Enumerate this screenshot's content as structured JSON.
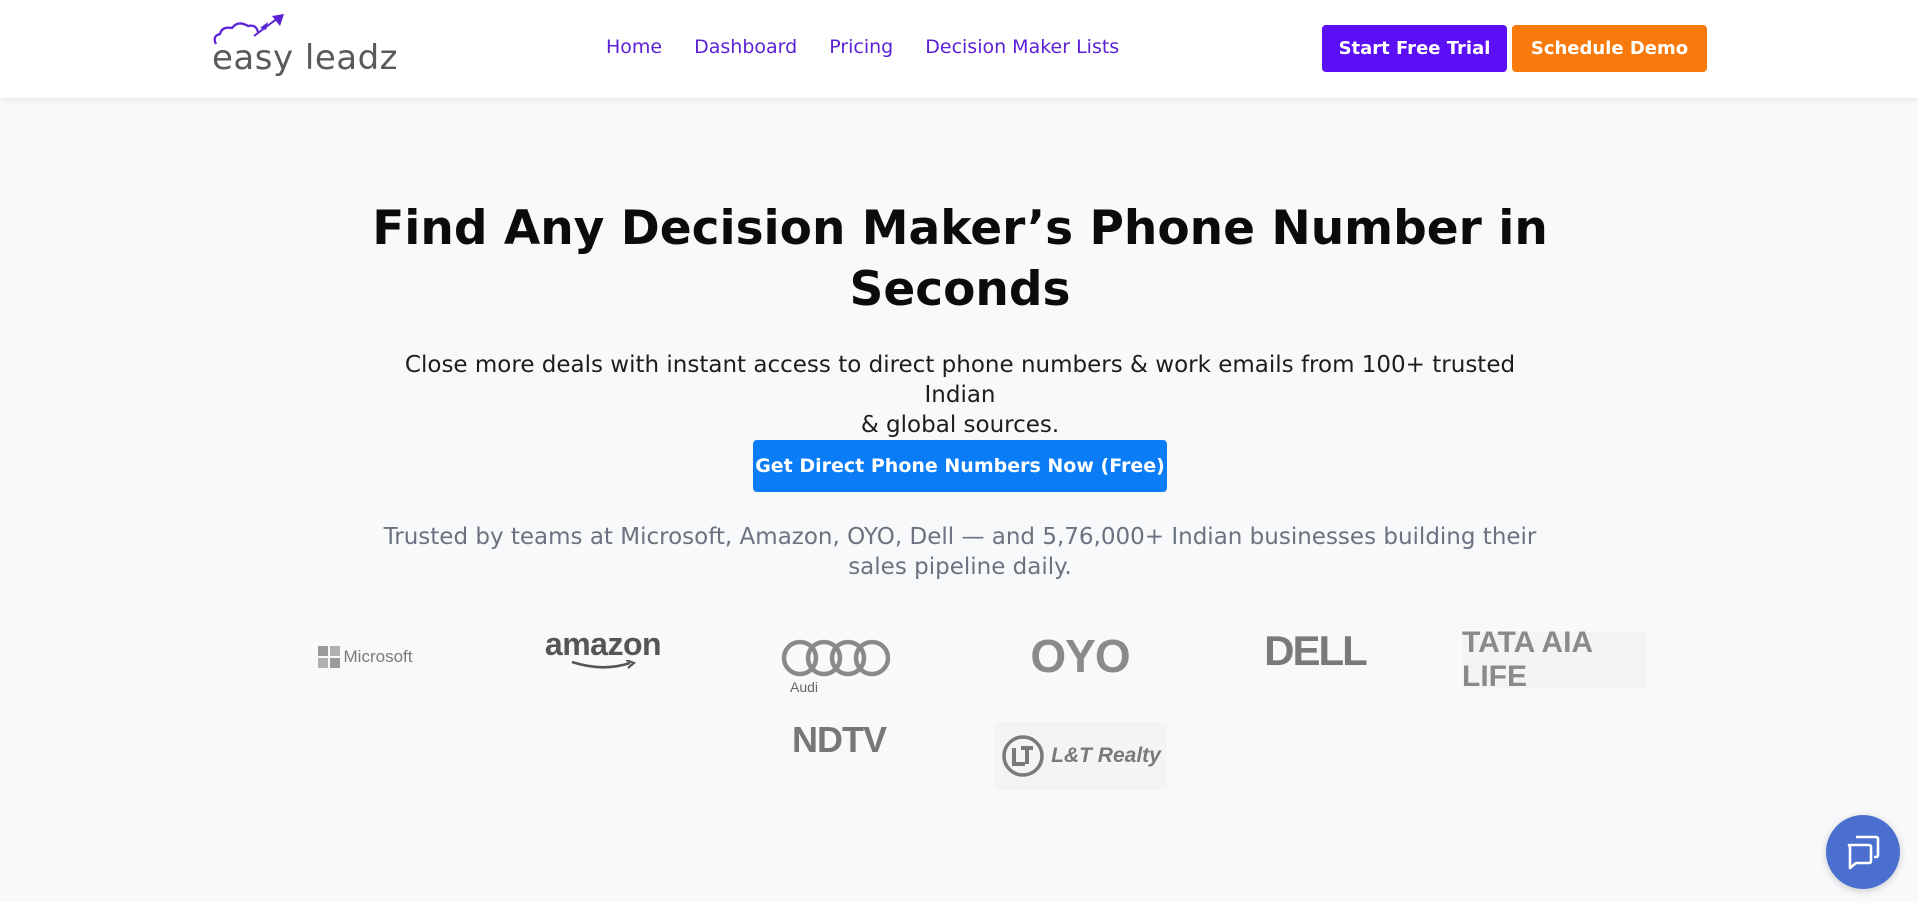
{
  "header": {
    "logo_text": "easy leadz",
    "nav": [
      "Home",
      "Dashboard",
      "Pricing",
      "Decision Maker Lists"
    ],
    "start_trial_label": "Start Free Trial",
    "schedule_demo_label": "Schedule Demo"
  },
  "hero": {
    "title_line1": "Find Any Decision Maker’s Phone Number in",
    "title_line2": "Seconds",
    "subtitle_line1": "Close more deals with instant access to direct phone numbers & work emails from 100+ trusted Indian",
    "subtitle_line2": "& global sources.",
    "cta_label": "Get Direct Phone Numbers Now (Free)",
    "trusted_line1": "Trusted by teams at Microsoft, Amazon, OYO, Dell — and 5,76,000+ Indian businesses building their",
    "trusted_line2": "sales pipeline daily."
  },
  "client_logos": [
    "Microsoft",
    "amazon",
    "Audi",
    "OYO",
    "DELL",
    "TATA AIA LIFE",
    "NDTV",
    "L&T Realty"
  ],
  "colors": {
    "brand_purple": "#5b0ff5",
    "nav_purple": "#5b21d6",
    "orange": "#f97a0c",
    "cta_blue": "#0a7cf5",
    "chat_blue": "#4a6fcf"
  },
  "icons": {
    "logo": "cloud-rocket-icon",
    "chat": "chat-bubbles-icon"
  }
}
